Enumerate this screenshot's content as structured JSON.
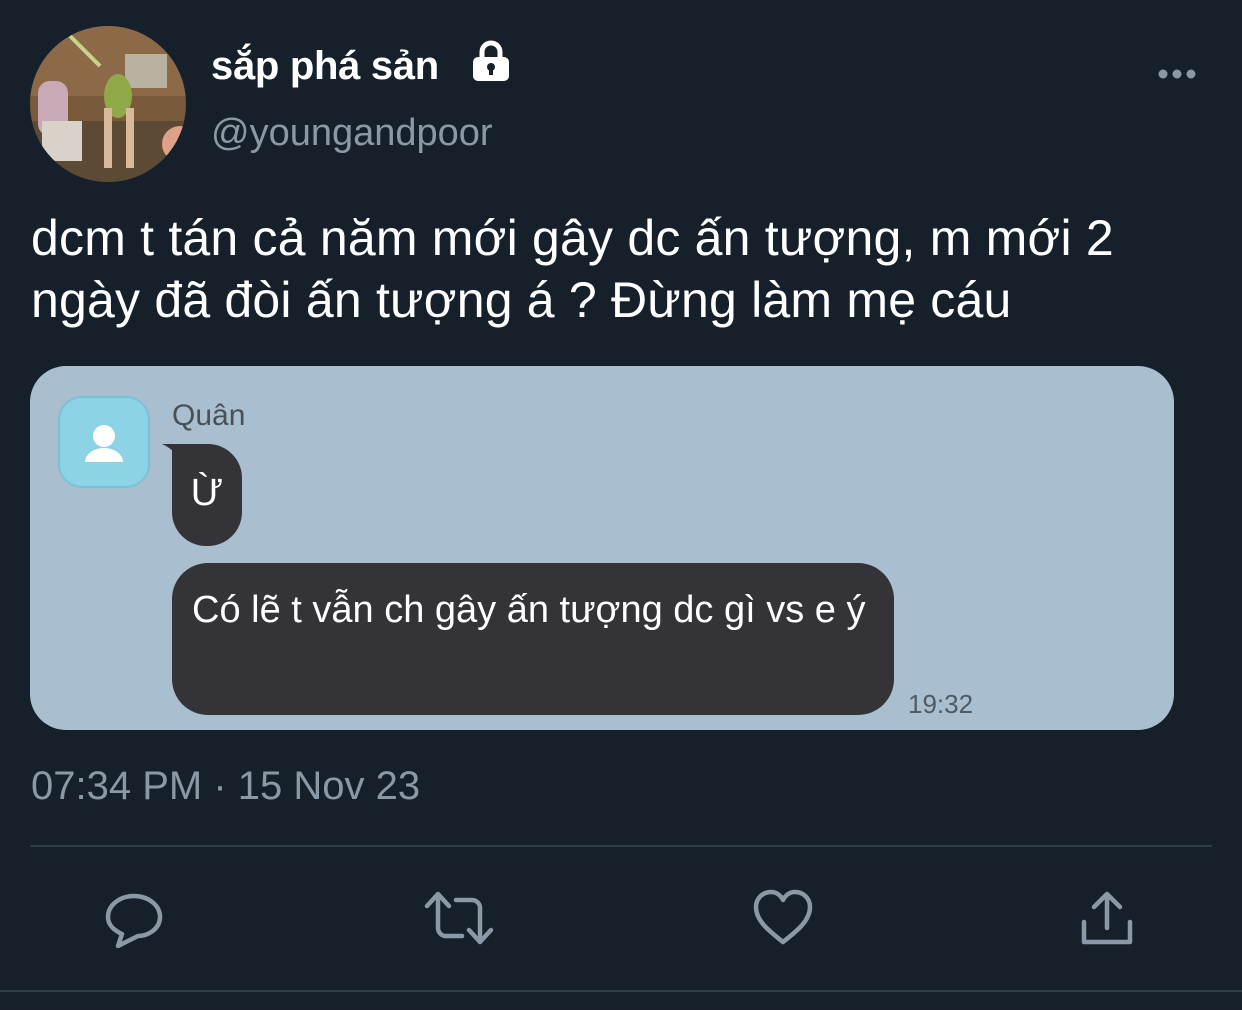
{
  "tweet": {
    "author": {
      "display_name": "sắp phá sản",
      "handle": "@youngandpoor",
      "protected": true,
      "avatar_icon": "profile-photo-cartoon"
    },
    "text": "dcm t tán cả năm mới gây dc ấn tượng, m mới 2 ngày đã đòi ấn tượng á ? Đừng làm mẹ cáu",
    "timestamp": "07:34 PM · 15 Nov 23"
  },
  "chat_screenshot": {
    "contact_name": "Quân",
    "contact_avatar_icon": "user-silhouette-icon",
    "messages": [
      {
        "text": "Ừ"
      },
      {
        "text": "Có lẽ t vẫn ch gây ấn tượng dc gì vs e ý",
        "time": "19:32"
      }
    ],
    "background_color": "#a9bfcf",
    "bubble_color": "#333338"
  },
  "actions": [
    {
      "icon": "reply-icon"
    },
    {
      "icon": "retweet-icon"
    },
    {
      "icon": "like-icon"
    },
    {
      "icon": "share-icon"
    }
  ],
  "colors": {
    "background": "#15202b",
    "secondary_text": "#8b98a5",
    "divider": "#2f3b46"
  }
}
